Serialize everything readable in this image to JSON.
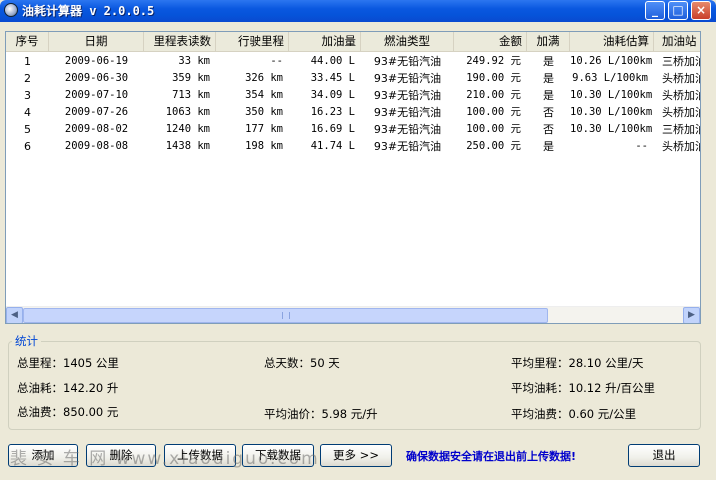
{
  "window": {
    "title": "油耗计算器 v 2.0.0.5",
    "minimize": "_",
    "maximize": "□",
    "close": "×"
  },
  "table": {
    "columns": [
      "序号",
      "日期",
      "里程表读数",
      "行驶里程",
      "加油量",
      "燃油类型",
      "金额",
      "加满",
      "油耗估算",
      "加油站"
    ],
    "rows": [
      {
        "no": "1",
        "date": "2009-06-19",
        "odo": "33 km",
        "dist": "--",
        "fuel": "44.00 L",
        "type": "93#无铅汽油",
        "amount": "249.92 元",
        "full": "是",
        "est": "10.26 L/100km",
        "station": "三桥加油站"
      },
      {
        "no": "2",
        "date": "2009-06-30",
        "odo": "359 km",
        "dist": "326 km",
        "fuel": "33.45 L",
        "type": "93#无铅汽油",
        "amount": "190.00 元",
        "full": "是",
        "est": "9.63 L/100km",
        "station": "头桥加油站"
      },
      {
        "no": "3",
        "date": "2009-07-10",
        "odo": "713 km",
        "dist": "354 km",
        "fuel": "34.09 L",
        "type": "93#无铅汽油",
        "amount": "210.00 元",
        "full": "是",
        "est": "10.30 L/100km",
        "station": "头桥加油站"
      },
      {
        "no": "4",
        "date": "2009-07-26",
        "odo": "1063 km",
        "dist": "350 km",
        "fuel": "16.23 L",
        "type": "93#无铅汽油",
        "amount": "100.00 元",
        "full": "否",
        "est": "10.30 L/100km",
        "station": "头桥加油站"
      },
      {
        "no": "5",
        "date": "2009-08-02",
        "odo": "1240 km",
        "dist": "177 km",
        "fuel": "16.69 L",
        "type": "93#无铅汽油",
        "amount": "100.00 元",
        "full": "否",
        "est": "10.30 L/100km",
        "station": "三桥加油站"
      },
      {
        "no": "6",
        "date": "2009-08-08",
        "odo": "1438 km",
        "dist": "198 km",
        "fuel": "41.74 L",
        "type": "93#无铅汽油",
        "amount": "250.00 元",
        "full": "是",
        "est": "--",
        "station": "头桥加油站"
      }
    ]
  },
  "stats": {
    "title": "统计",
    "total_mileage": "总里程：1405 公里",
    "total_days": "总天数：50 天",
    "avg_mileage": "平均里程：28.10 公里/天",
    "total_fuel": "总油耗：142.20 升",
    "avg_fuel": "平均油耗：10.12 升/百公里",
    "total_cost": "总油费：850.00 元",
    "avg_price": "平均油价：5.98 元/升",
    "avg_cost": "平均油费：0.60 元/公里"
  },
  "buttons": {
    "add": "添加",
    "delete": "删除",
    "upload": "上传数据",
    "download": "下载数据",
    "more": "更多 >>",
    "exit": "退出"
  },
  "notice": "确保数据安全请在退出前上传数据!",
  "watermark": "裴 安 车 网 www.xiaodiguo.com"
}
